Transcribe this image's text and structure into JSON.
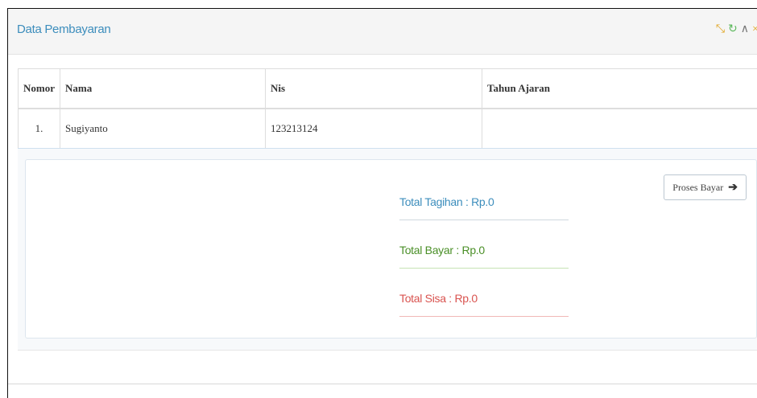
{
  "panel": {
    "title": "Data Pembayaran",
    "tools": {
      "expand_icon": "⤡",
      "refresh_icon": "↻",
      "collapse_icon": "∧",
      "close_icon": "×"
    }
  },
  "table": {
    "headers": [
      "Nomor",
      "Nama",
      "Nis",
      "Tahun Ajaran"
    ],
    "rows": [
      {
        "nomor": "1.",
        "nama": "Sugiyanto",
        "nis": "123213124",
        "tahun_ajaran": ""
      }
    ]
  },
  "summary": {
    "total_tagihan": "Total Tagihan : Rp.0",
    "total_bayar": "Total Bayar : Rp.0",
    "total_sisa": "Total Sisa : Rp.0",
    "proses_label": "Proses Bayar",
    "arrow_icon": "➔"
  },
  "colors": {
    "title": "#3c8dbc",
    "tagihan": "#3c8dbc",
    "bayar": "#4a8f27",
    "sisa": "#d9534f"
  }
}
